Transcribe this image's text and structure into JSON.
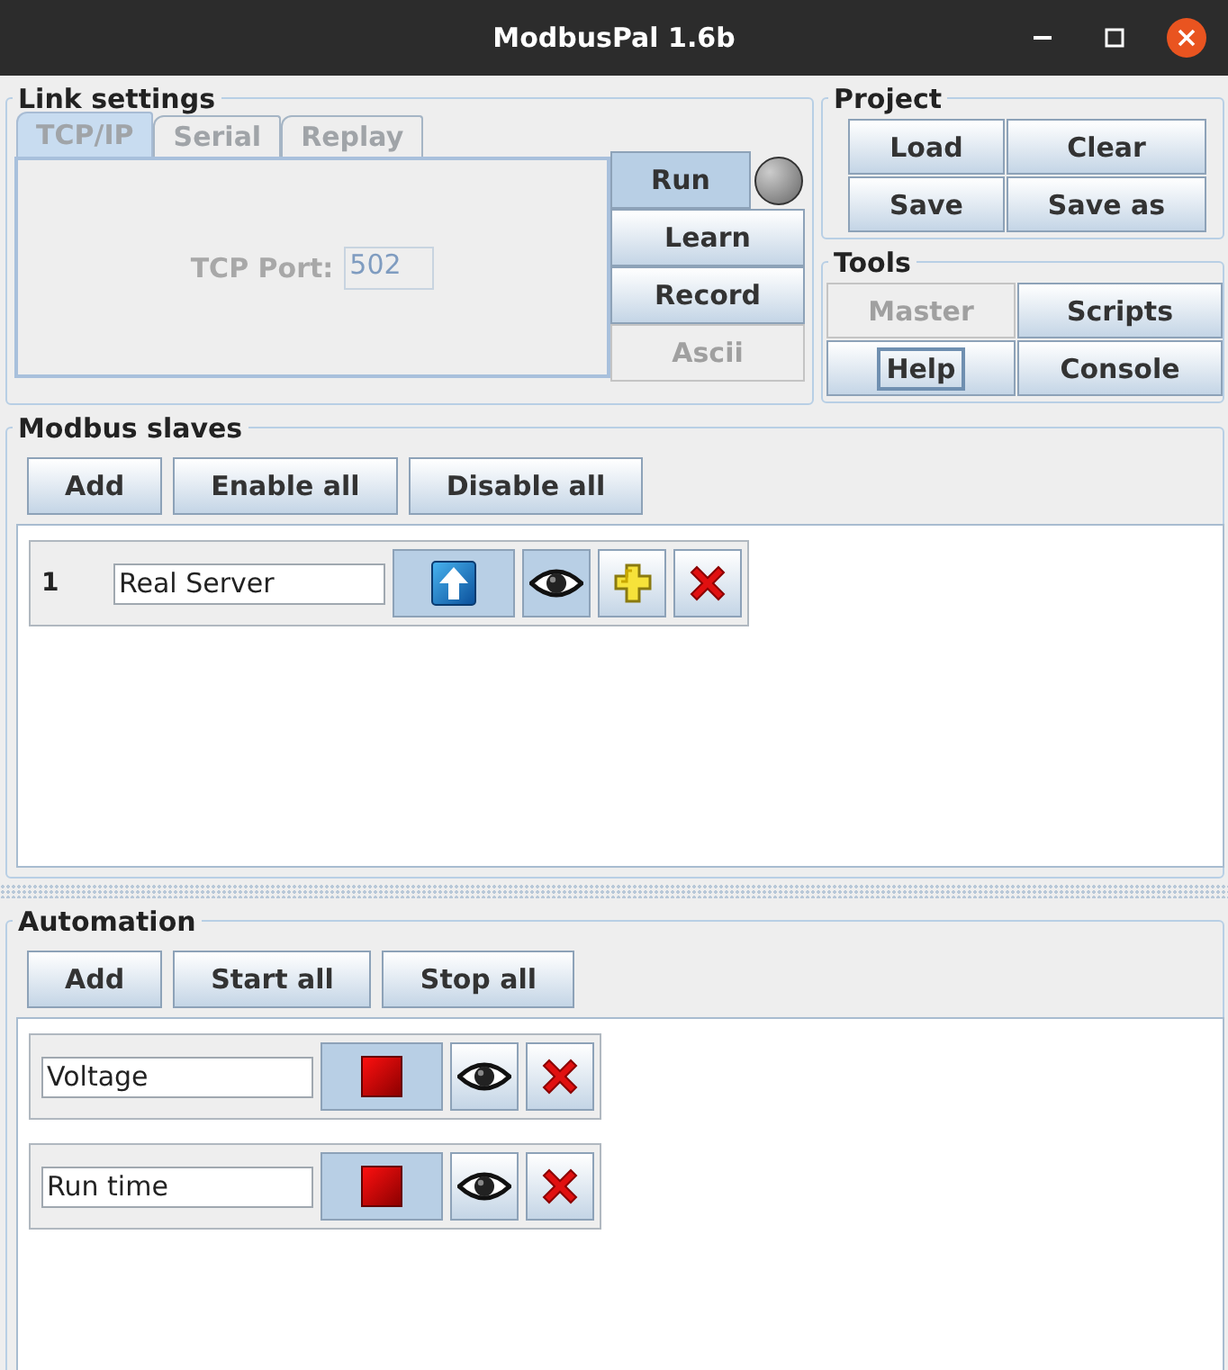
{
  "window": {
    "title": "ModbusPal 1.6b"
  },
  "link_settings": {
    "title": "Link settings",
    "tabs": [
      {
        "label": "TCP/IP",
        "selected": true
      },
      {
        "label": "Serial",
        "selected": false
      },
      {
        "label": "Replay",
        "selected": false
      }
    ],
    "tcp_port_label": "TCP Port:",
    "tcp_port": {
      "value": "502",
      "disabled": true
    },
    "buttons": [
      {
        "label": "Run",
        "pressed": true,
        "disabled": false
      },
      {
        "label": "Learn",
        "pressed": false,
        "disabled": false
      },
      {
        "label": "Record",
        "pressed": false,
        "disabled": false
      },
      {
        "label": "Ascii",
        "pressed": false,
        "disabled": true
      }
    ],
    "status_led": {
      "on": false
    }
  },
  "project": {
    "title": "Project",
    "buttons": [
      "Load",
      "Clear",
      "Save",
      "Save as"
    ]
  },
  "tools": {
    "title": "Tools",
    "buttons": [
      {
        "label": "Master",
        "disabled": true,
        "focused": false
      },
      {
        "label": "Scripts",
        "disabled": false,
        "focused": false
      },
      {
        "label": "Help",
        "disabled": false,
        "focused": true
      },
      {
        "label": "Console",
        "disabled": false,
        "focused": false
      }
    ]
  },
  "modbus_slaves": {
    "title": "Modbus slaves",
    "buttons": [
      "Add",
      "Enable all",
      "Disable all"
    ],
    "slaves": [
      {
        "id": "1",
        "name": "Real Server",
        "enabled": true,
        "viewing": true
      }
    ]
  },
  "automation": {
    "title": "Automation",
    "buttons": [
      "Add",
      "Start all",
      "Stop all"
    ],
    "automations": [
      {
        "name": "Voltage",
        "running": true,
        "viewing": false
      },
      {
        "name": "Run time",
        "running": true,
        "viewing": false
      }
    ]
  }
}
